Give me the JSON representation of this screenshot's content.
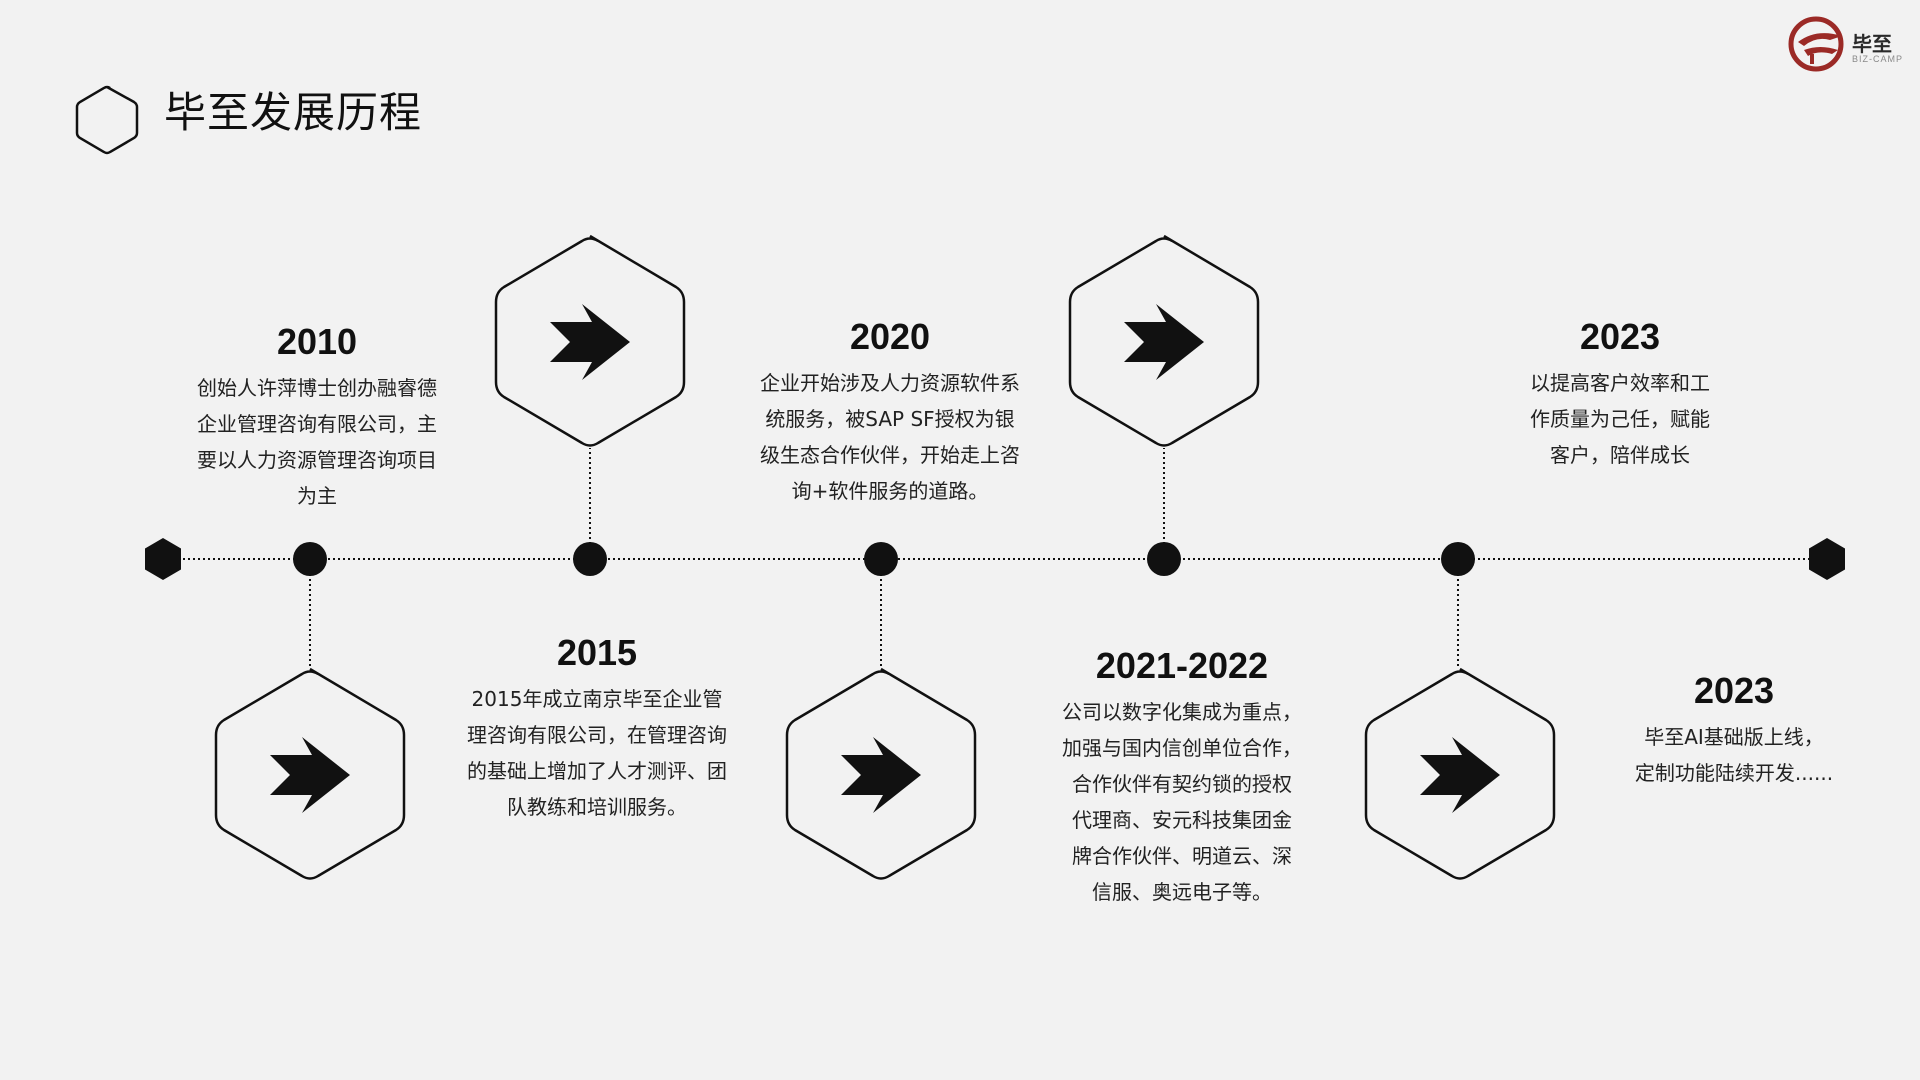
{
  "header": {
    "title": "毕至发展历程"
  },
  "logo": {
    "name_cn": "毕至",
    "name_en": "BIZ-CAMP",
    "color": "#9b2a26"
  },
  "colors": {
    "background": "#f2f2f2",
    "ink": "#111111",
    "logo_accent": "#9b2a26"
  },
  "icons": {
    "milestone": "arrow-right-icon",
    "title": "hexagon-outline-icon"
  },
  "events": [
    {
      "year": "2010",
      "lines": [
        "创始人许萍博士创办融睿德",
        "企业管理咨询有限公司，主",
        "要以人力资源管理咨询项目",
        "为主"
      ]
    },
    {
      "year": "2015",
      "lines": [
        "2015年成立南京毕至企业管",
        "理咨询有限公司，在管理咨询",
        "的基础上增加了人才测评、团",
        "队教练和培训服务。"
      ]
    },
    {
      "year": "2020",
      "lines": [
        "企业开始涉及人力资源软件系",
        "统服务，被SAP SF授权为银",
        "级生态合作伙伴，开始走上咨",
        "询+软件服务的道路。"
      ]
    },
    {
      "year": "2021-2022",
      "lines": [
        "公司以数字化集成为重点，",
        "加强与国内信创单位合作，",
        "合作伙伴有契约锁的授权",
        "代理商、安元科技集团金",
        "牌合作伙伴、明道云、深",
        "信服、奥远电子等。"
      ]
    },
    {
      "year": "2023",
      "lines": [
        "以提高客户效率和工",
        "作质量为己任，赋能",
        "客户，陪伴成长"
      ]
    },
    {
      "year": "2023",
      "lines": [
        "毕至AI基础版上线，",
        "定制功能陆续开发......"
      ]
    }
  ]
}
